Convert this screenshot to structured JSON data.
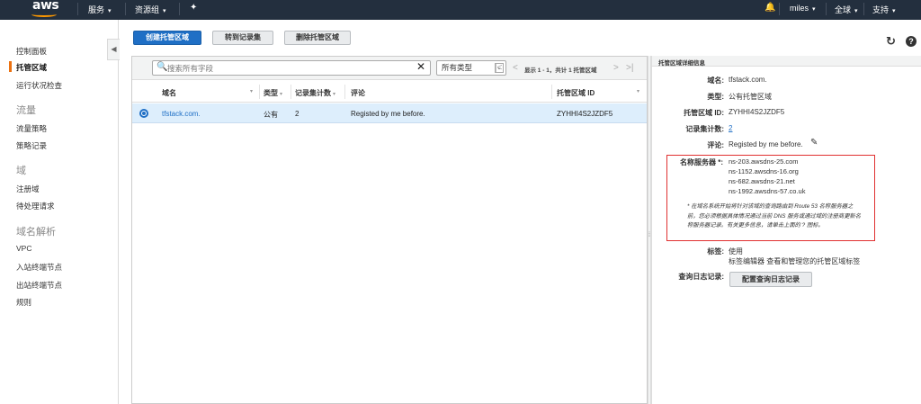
{
  "topnav": {
    "logo": "aws",
    "services": "服务",
    "resource_groups": "资源组",
    "user": "miles",
    "region": "全球",
    "support": "支持"
  },
  "sidebar": {
    "items": [
      {
        "label": "控制面板"
      },
      {
        "label": "托管区域"
      },
      {
        "label": "运行状况检查"
      },
      {
        "label": "流量策略"
      },
      {
        "label": "策略记录"
      },
      {
        "label": "注册域"
      },
      {
        "label": "待处理请求"
      },
      {
        "label": "VPC"
      },
      {
        "label": "入站终端节点"
      },
      {
        "label": "出站终端节点"
      },
      {
        "label": "规则"
      }
    ],
    "sections": [
      "流量",
      "域",
      "域名解析"
    ]
  },
  "toolbar": {
    "create": "创建托管区域",
    "goto_records": "转到记录集",
    "delete": "删除托管区域"
  },
  "table": {
    "search_placeholder": "搜索所有字段",
    "type_filter": "所有类型",
    "pager": "显示 1 - 1，共计 1 托管区域",
    "columns": [
      "域名",
      "类型",
      "记录集计数",
      "评论",
      "托管区域 ID"
    ],
    "rows": [
      {
        "domain": "tfstack.com.",
        "type": "公有",
        "count": "2",
        "comment": "Registed by me before.",
        "zone_id": "ZYHHI4S2JZDF5"
      }
    ]
  },
  "detail": {
    "title": "托管区域详细信息",
    "domain_label": "域名:",
    "domain_value": "tfstack.com.",
    "type_label": "类型:",
    "type_value": "公有托管区域",
    "zone_id_label": "托管区域 ID:",
    "zone_id_value": "ZYHHI4S2JZDF5",
    "count_label": "记录集计数:",
    "count_value": "2",
    "comment_label": "评论:",
    "comment_value": "Registed by me before.",
    "ns_label": "名称服务器 *:",
    "ns": [
      "ns-203.awsdns-25.com",
      "ns-1152.awsdns-16.org",
      "ns-682.awsdns-21.net",
      "ns-1992.awsdns-57.co.uk"
    ],
    "ns_note": "* 在域名系统开始将针对该域的查询路由到 Route 53 名称服务器之前，您必须根据具体情况通过当前 DNS 服务或通过域的注册商更新名称服务器记录。有关更多信息，请单击上面的 ? 图标。",
    "tags_label": "标签:",
    "tags_value": "使用",
    "tags_note": "标签编辑器 查看和管理您的托管区域标签",
    "query_log_label": "查询日志记录:",
    "query_log_button": "配置查询日志记录"
  }
}
